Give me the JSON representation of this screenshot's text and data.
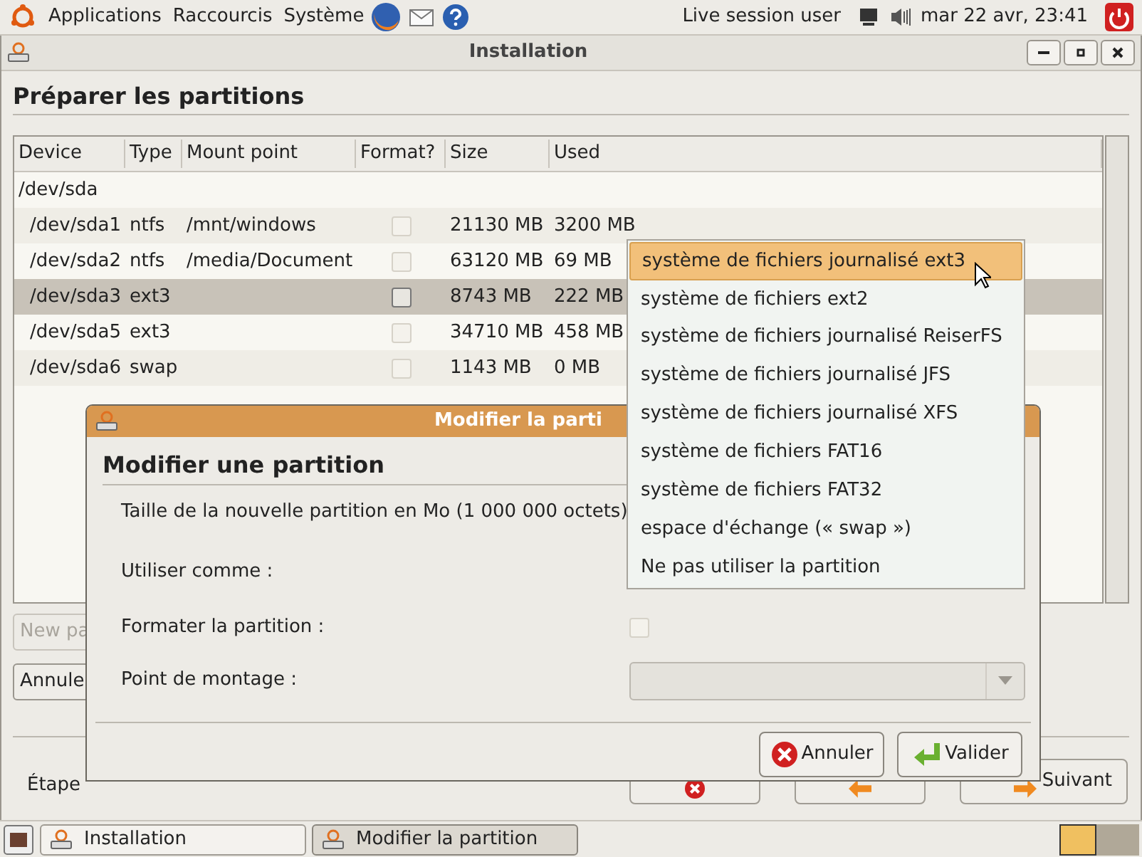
{
  "top_panel": {
    "menus": [
      "Applications",
      "Raccourcis",
      "Système"
    ],
    "user": "Live session user",
    "clock": "mar 22 avr, 23:41"
  },
  "window": {
    "title": "Installation",
    "heading": "Préparer les partitions",
    "table": {
      "columns": [
        "Device",
        "Type",
        "Mount point",
        "Format?",
        "Size",
        "Used"
      ],
      "rows": [
        {
          "kind": "disk",
          "device": "/dev/sda",
          "selected": false
        },
        {
          "kind": "partition",
          "device": "/dev/sda1",
          "type": "ntfs",
          "mount": "/mnt/windows",
          "format": false,
          "size": "21130 MB",
          "used": "3200 MB",
          "selected": false
        },
        {
          "kind": "partition",
          "device": "/dev/sda2",
          "type": "ntfs",
          "mount": "/media/Document",
          "format": false,
          "size": "63120 MB",
          "used": "69 MB",
          "selected": false
        },
        {
          "kind": "partition",
          "device": "/dev/sda3",
          "type": "ext3",
          "format": false,
          "size": "8743 MB",
          "used": "222 MB",
          "selected": true
        },
        {
          "kind": "partition",
          "device": "/dev/sda5",
          "type": "ext3",
          "format": false,
          "size": "34710 MB",
          "used": "458 MB",
          "selected": false
        },
        {
          "kind": "partition",
          "device": "/dev/sda6",
          "type": "swap",
          "format": false,
          "size": "1143 MB",
          "used": "0 MB",
          "selected": false
        }
      ]
    },
    "new_partition_button": {
      "label": "New pa",
      "disabled": true
    },
    "undo_button": {
      "label": "Annule",
      "disabled": false
    },
    "step": "Étape",
    "nav_buttons": [
      {
        "kind": "cancel"
      },
      {
        "kind": "back"
      },
      {
        "kind": "next",
        "label": "Suivant"
      }
    ]
  },
  "dialog": {
    "title": "Modifier la parti",
    "heading": "Modifier une partition",
    "labels": [
      "Taille de la nouvelle partition en Mo (1 000 000 octets)",
      "Utiliser comme :",
      "Formater la partition :",
      "Point de montage :"
    ],
    "format_checkbox": {
      "checked": false
    },
    "buttons": [
      {
        "kind": "cancel",
        "label": "Annuler"
      },
      {
        "kind": "ok",
        "label": "Valider"
      }
    ]
  },
  "dropdown": {
    "options": [
      {
        "label": "système de fichiers journalisé ext3",
        "selected": true
      },
      {
        "label": "système de fichiers ext2",
        "selected": false
      },
      {
        "label": "système de fichiers journalisé ReiserFS",
        "selected": false
      },
      {
        "label": "système de fichiers journalisé JFS",
        "selected": false
      },
      {
        "label": "système de fichiers journalisé XFS",
        "selected": false
      },
      {
        "label": "système de fichiers FAT16",
        "selected": false
      },
      {
        "label": "système de fichiers FAT32",
        "selected": false
      },
      {
        "label": "espace d'échange (« swap »)",
        "selected": false
      },
      {
        "label": "Ne pas utiliser la partition",
        "selected": false
      }
    ]
  },
  "taskbar": {
    "items": [
      {
        "label": "Installation",
        "selected": false
      },
      {
        "label": "Modifier la partition",
        "selected": true
      }
    ]
  }
}
